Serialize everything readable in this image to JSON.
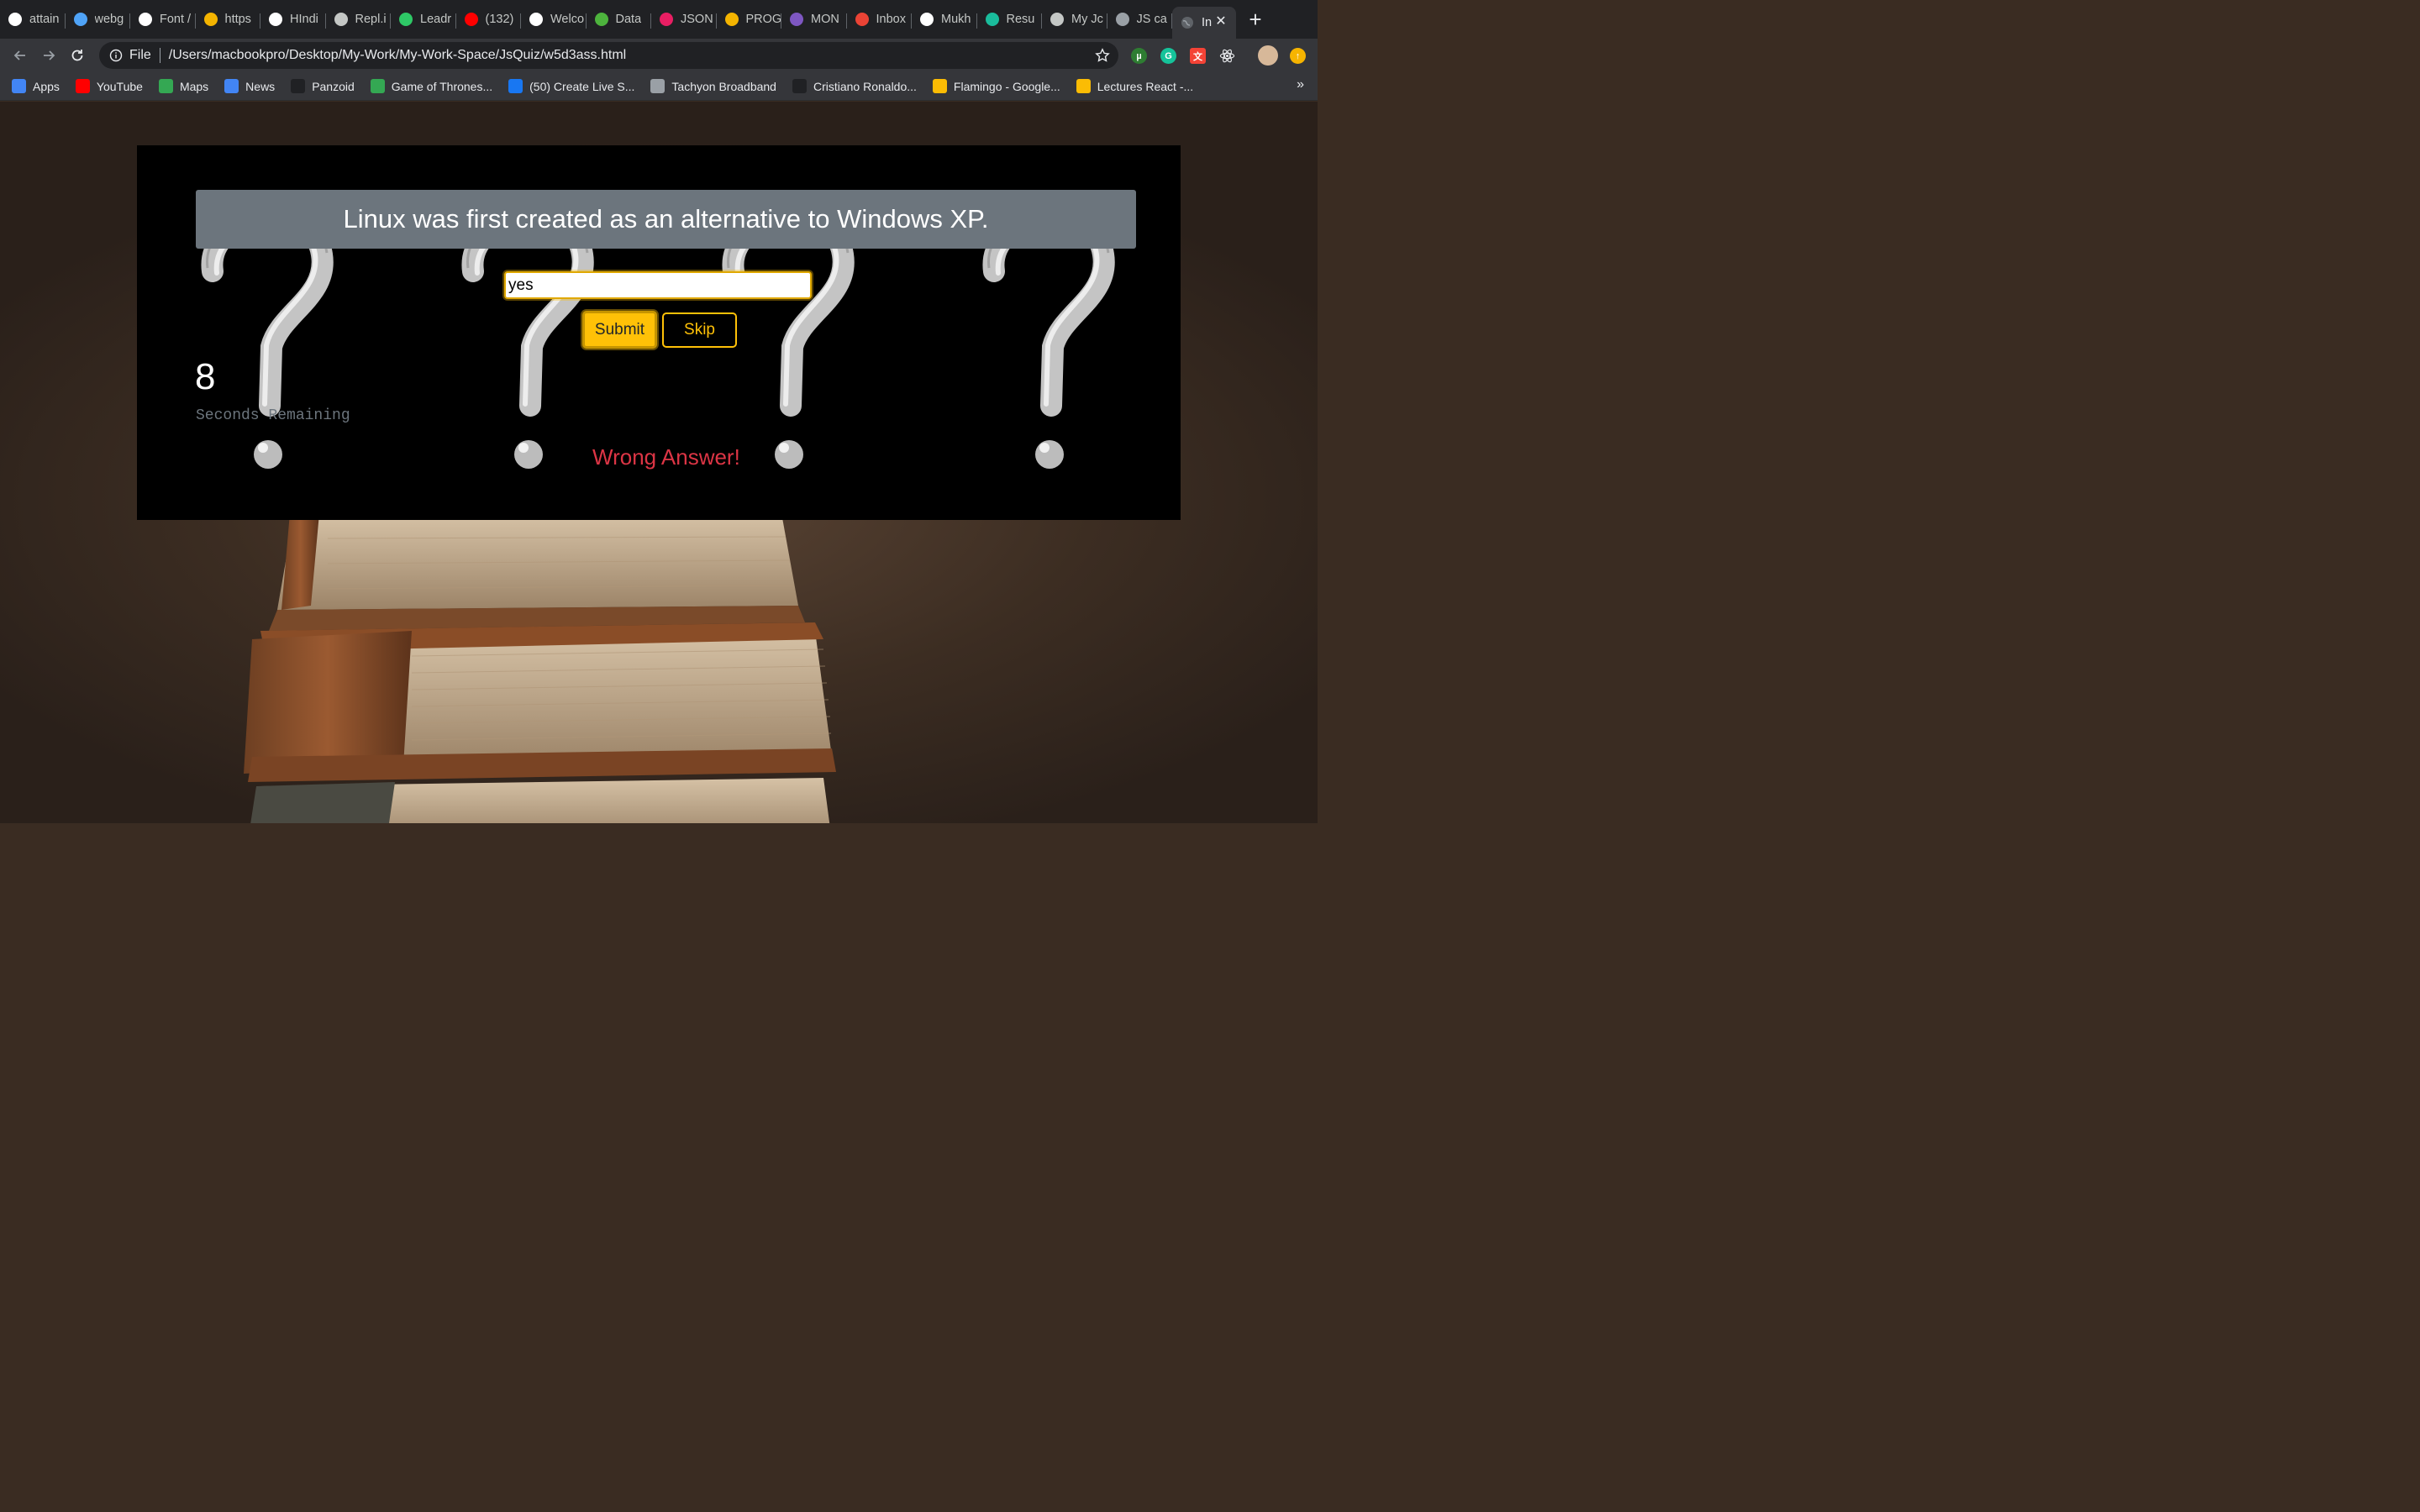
{
  "browser": {
    "tabs": [
      {
        "label": "attain",
        "icon": "github-icon",
        "color": "#ffffff"
      },
      {
        "label": "webg",
        "icon": "globe-icon",
        "color": "#4fa3f7"
      },
      {
        "label": "Font /",
        "icon": "flag-icon",
        "color": "#ffffff"
      },
      {
        "label": "https",
        "icon": "stack-icon",
        "color": "#f4b400"
      },
      {
        "label": "HIndi",
        "icon": "film-icon",
        "color": "#ffffff"
      },
      {
        "label": "Repl.i",
        "icon": "replit-icon",
        "color": "#c4c7c5"
      },
      {
        "label": "Leadr",
        "icon": "hackerrank-icon",
        "color": "#2ec866"
      },
      {
        "label": "(132)",
        "icon": "youtube-icon",
        "color": "#ff0000"
      },
      {
        "label": "Welco",
        "icon": "outlook-icon",
        "color": "#ffffff"
      },
      {
        "label": "Data",
        "icon": "leaf-icon",
        "color": "#4db33d"
      },
      {
        "label": "JSON",
        "icon": "json-icon",
        "color": "#e91e63"
      },
      {
        "label": "PROG",
        "icon": "hand-icon",
        "color": "#f4b400"
      },
      {
        "label": "MON",
        "icon": "list-icon",
        "color": "#7e57c2"
      },
      {
        "label": "Inbox",
        "icon": "gmail-icon",
        "color": "#ea4335"
      },
      {
        "label": "Mukh",
        "icon": "github-icon",
        "color": "#ffffff"
      },
      {
        "label": "Resu",
        "icon": "infinity-icon",
        "color": "#1abc9c"
      },
      {
        "label": "My Jc",
        "icon": "rocket-icon",
        "color": "#c4c7c5"
      },
      {
        "label": "JS ca",
        "icon": "globe-icon",
        "color": "#9aa0a6"
      }
    ],
    "active_tab": {
      "label": "In",
      "icon": "globe-icon",
      "close": "✕"
    },
    "new_tab": "+",
    "omnibox": {
      "scheme": "File",
      "url": "/Users/macbookpro/Desktop/My-Work/My-Work-Space/JsQuiz/w5d3ass.html"
    },
    "bookmarks": [
      {
        "label": "Apps",
        "icon": "apps-grid-icon",
        "color": "#4285f4"
      },
      {
        "label": "YouTube",
        "icon": "youtube-icon",
        "color": "#ff0000"
      },
      {
        "label": "Maps",
        "icon": "maps-pin-icon",
        "color": "#34a853"
      },
      {
        "label": "News",
        "icon": "google-news-icon",
        "color": "#4285f4"
      },
      {
        "label": "Panzoid",
        "icon": "panzoid-icon",
        "color": "#202124"
      },
      {
        "label": "Game of Thrones...",
        "icon": "play-circle-icon",
        "color": "#34a853"
      },
      {
        "label": "(50) Create Live S...",
        "icon": "facebook-icon",
        "color": "#1877f2"
      },
      {
        "label": "Tachyon Broadband",
        "icon": "tachyon-icon",
        "color": "#9aa0a6"
      },
      {
        "label": "Cristiano Ronaldo...",
        "icon": "slash-logo-icon",
        "color": "#202124"
      },
      {
        "label": "Flamingo - Google...",
        "icon": "google-drive-icon",
        "color": "#fbbc04"
      },
      {
        "label": "Lectures React -...",
        "icon": "google-drive-icon",
        "color": "#fbbc04"
      }
    ],
    "bookmarks_more": "»"
  },
  "quiz": {
    "question": "Linux was first created as an alternative to Windows XP.",
    "answer_value": "yes",
    "submit_label": "Submit",
    "skip_label": "Skip",
    "timer_value": "8",
    "timer_label": "Seconds Remaining",
    "feedback": "Wrong Answer!",
    "colors": {
      "card_bg": "#000000",
      "question_bg": "#6c757d",
      "accent": "#ffc107",
      "error": "#dc3545",
      "muted": "#6c757d"
    }
  }
}
